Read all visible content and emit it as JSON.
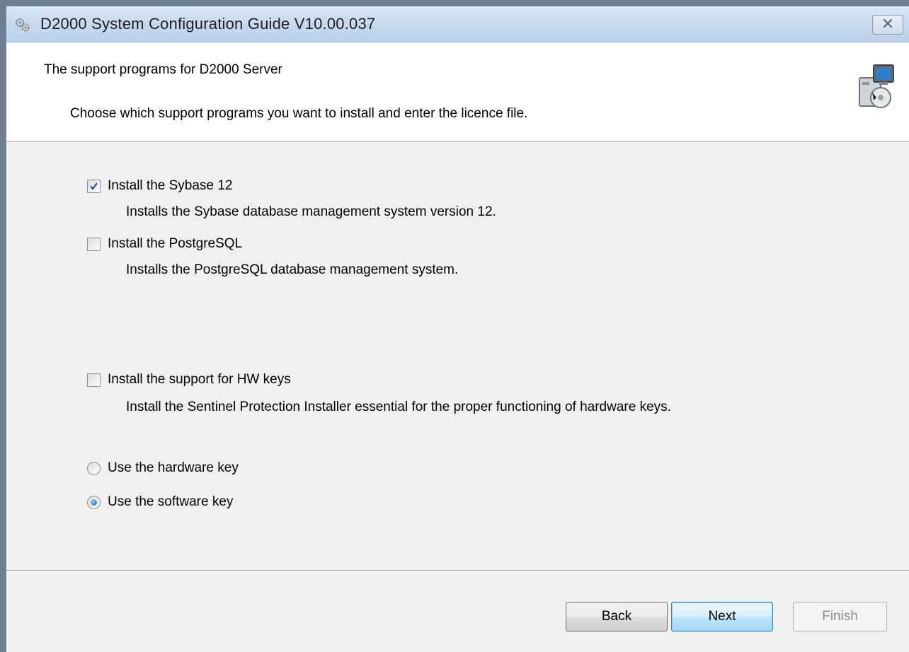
{
  "window": {
    "title": "D2000 System Configuration Guide V10.00.037",
    "icons": {
      "app": "gears-icon",
      "close": "close-icon",
      "header": "setup-computer-icon"
    }
  },
  "header": {
    "title": "The support programs for D2000 Server",
    "subtitle": "Choose which support programs you want to install and enter the licence file."
  },
  "options": [
    {
      "label": "Install the Sybase 12",
      "description": "Installs the Sybase database management system version 12.",
      "checked": true
    },
    {
      "label": "Install the PostgreSQL",
      "description": "Installs the PostgreSQL database management system.",
      "checked": false
    },
    {
      "label": "Install the support for HW keys",
      "description": "Install the Sentinel Protection Installer essential for the proper functioning of hardware keys.",
      "checked": false
    }
  ],
  "license_key": {
    "options": [
      {
        "label": "Use the hardware key",
        "selected": false
      },
      {
        "label": "Use the software key",
        "selected": true
      }
    ]
  },
  "buttons": {
    "back": "Back",
    "next": "Next",
    "finish": "Finish"
  },
  "colors": {
    "accent": "#3c7fb1",
    "disabled_text": "#8d8d8d"
  }
}
